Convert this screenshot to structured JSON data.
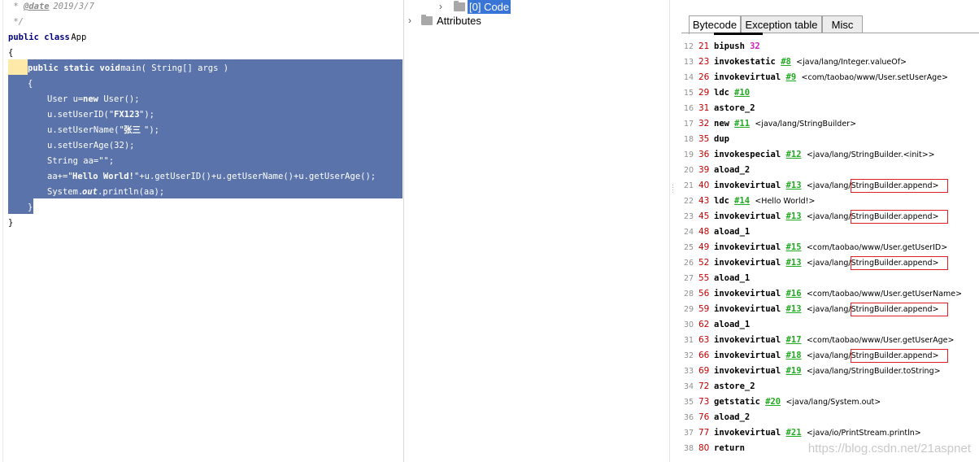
{
  "editor": {
    "lines": {
      "date_comment_prefix": " * ",
      "date_tag": "@date",
      "date_value": " 2019/3/7",
      "comment_end": " */",
      "class_kw": "public class",
      "class_name": " App",
      "open_brace": "{",
      "main_kw": "public static void",
      "main_sig": " main( String[] args )",
      "inner_open": "{",
      "l1": "User u=",
      "l1_kw": "new",
      "l1_rest": " User();",
      "l2": "u.setUserID(\"",
      "l2_str": "FX123",
      "l2_rest": "\");",
      "l3": "u.setUserName(\"",
      "l3_str": "张三",
      "l3_rest": "\");",
      "l4": "u.setUserAge(32);",
      "l5": "String aa=\"\";",
      "l6": "aa+=\"",
      "l6_str": "Hello World!",
      "l6_rest": "\"+u.getUserID()+u.getUserName()+u.getUserAge();",
      "l7": "System.",
      "l7_out": "out",
      "l7_rest": ".println(aa);",
      "inner_close": "}",
      "close_brace": "}"
    }
  },
  "tree": {
    "code_node": "[0] Code",
    "attributes_node": "Attributes"
  },
  "bytecode": {
    "tabs": [
      "Bytecode",
      "Exception table",
      "Misc"
    ],
    "rows": [
      {
        "ln": "12",
        "off": "21",
        "op": "bipush",
        "num": "32",
        "ref": "",
        "arg": "",
        "box": false
      },
      {
        "ln": "13",
        "off": "23",
        "op": "invokestatic",
        "ref": "#8",
        "arg": "<java/lang/Integer.valueOf>",
        "box": false
      },
      {
        "ln": "14",
        "off": "26",
        "op": "invokevirtual",
        "ref": "#9",
        "arg": "<com/taobao/www/User.setUserAge>",
        "box": false
      },
      {
        "ln": "15",
        "off": "29",
        "op": "ldc",
        "ref": "#10",
        "arg": "",
        "box": false
      },
      {
        "ln": "16",
        "off": "31",
        "op": "astore_2",
        "ref": "",
        "arg": "",
        "box": false
      },
      {
        "ln": "17",
        "off": "32",
        "op": "new",
        "ref": "#11",
        "arg": "<java/lang/StringBuilder>",
        "box": false
      },
      {
        "ln": "18",
        "off": "35",
        "op": "dup",
        "ref": "",
        "arg": "",
        "box": false
      },
      {
        "ln": "19",
        "off": "36",
        "op": "invokespecial",
        "ref": "#12",
        "arg": "<java/lang/StringBuilder.<init>>",
        "box": false
      },
      {
        "ln": "20",
        "off": "39",
        "op": "aload_2",
        "ref": "",
        "arg": "",
        "box": false
      },
      {
        "ln": "21",
        "off": "40",
        "op": "invokevirtual",
        "ref": "#13",
        "arg": "<java/lang/StringBuilder.append>",
        "box": true
      },
      {
        "ln": "22",
        "off": "43",
        "op": "ldc",
        "ref": "#14",
        "arg": "<Hello World!>",
        "box": false
      },
      {
        "ln": "23",
        "off": "45",
        "op": "invokevirtual",
        "ref": "#13",
        "arg": "<java/lang/StringBuilder.append>",
        "box": true
      },
      {
        "ln": "24",
        "off": "48",
        "op": "aload_1",
        "ref": "",
        "arg": "",
        "box": false
      },
      {
        "ln": "25",
        "off": "49",
        "op": "invokevirtual",
        "ref": "#15",
        "arg": "<com/taobao/www/User.getUserID>",
        "box": false
      },
      {
        "ln": "26",
        "off": "52",
        "op": "invokevirtual",
        "ref": "#13",
        "arg": "<java/lang/StringBuilder.append>",
        "box": true
      },
      {
        "ln": "27",
        "off": "55",
        "op": "aload_1",
        "ref": "",
        "arg": "",
        "box": false
      },
      {
        "ln": "28",
        "off": "56",
        "op": "invokevirtual",
        "ref": "#16",
        "arg": "<com/taobao/www/User.getUserName>",
        "box": false
      },
      {
        "ln": "29",
        "off": "59",
        "op": "invokevirtual",
        "ref": "#13",
        "arg": "<java/lang/StringBuilder.append>",
        "box": true
      },
      {
        "ln": "30",
        "off": "62",
        "op": "aload_1",
        "ref": "",
        "arg": "",
        "box": false
      },
      {
        "ln": "31",
        "off": "63",
        "op": "invokevirtual",
        "ref": "#17",
        "arg": "<com/taobao/www/User.getUserAge>",
        "box": false
      },
      {
        "ln": "32",
        "off": "66",
        "op": "invokevirtual",
        "ref": "#18",
        "arg": "<java/lang/StringBuilder.append>",
        "box": true
      },
      {
        "ln": "33",
        "off": "69",
        "op": "invokevirtual",
        "ref": "#19",
        "arg": "<java/lang/StringBuilder.toString>",
        "box": false
      },
      {
        "ln": "34",
        "off": "72",
        "op": "astore_2",
        "ref": "",
        "arg": "",
        "box": false
      },
      {
        "ln": "35",
        "off": "73",
        "op": "getstatic",
        "ref": "#20",
        "arg": "<java/lang/System.out>",
        "box": false
      },
      {
        "ln": "36",
        "off": "76",
        "op": "aload_2",
        "ref": "",
        "arg": "",
        "box": false
      },
      {
        "ln": "37",
        "off": "77",
        "op": "invokevirtual",
        "ref": "#21",
        "arg": "<java/io/PrintStream.println>",
        "box": false
      },
      {
        "ln": "38",
        "off": "80",
        "op": "return",
        "ref": "",
        "arg": "",
        "box": false
      }
    ],
    "watermark": "https://blog.csdn.net/21aspnet"
  },
  "colors": {
    "selection": "#5a73aa",
    "offset": "#c00000",
    "ref": "#22aa22",
    "number": "#d020c0",
    "highlight_box": "#e02020",
    "tree_selected": "#3875d7"
  }
}
